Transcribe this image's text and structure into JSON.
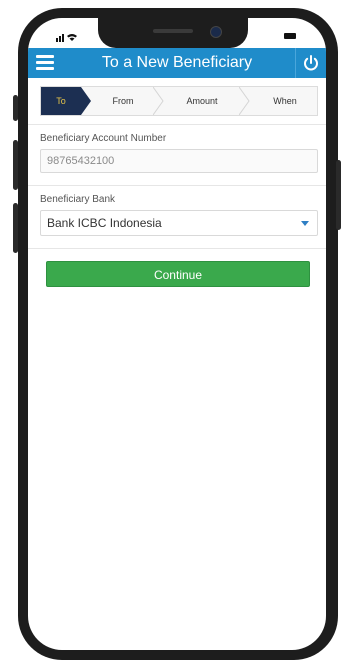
{
  "header": {
    "title": "To a New Beneficiary",
    "menu_icon": "hamburger-menu-icon",
    "power_icon": "power-icon"
  },
  "steps": [
    {
      "label": "To",
      "active": true
    },
    {
      "label": "From",
      "active": false
    },
    {
      "label": "Amount",
      "active": false
    },
    {
      "label": "When",
      "active": false
    }
  ],
  "account": {
    "label": "Beneficiary Account Number",
    "value": "98765432100"
  },
  "bank": {
    "label": "Beneficiary Bank",
    "selected": "Bank ICBC Indonesia"
  },
  "continue_label": "Continue",
  "colors": {
    "header": "#1f8cca",
    "active_step": "#1c2f52",
    "active_step_text": "#e8c64a",
    "continue": "#3aa94c"
  }
}
